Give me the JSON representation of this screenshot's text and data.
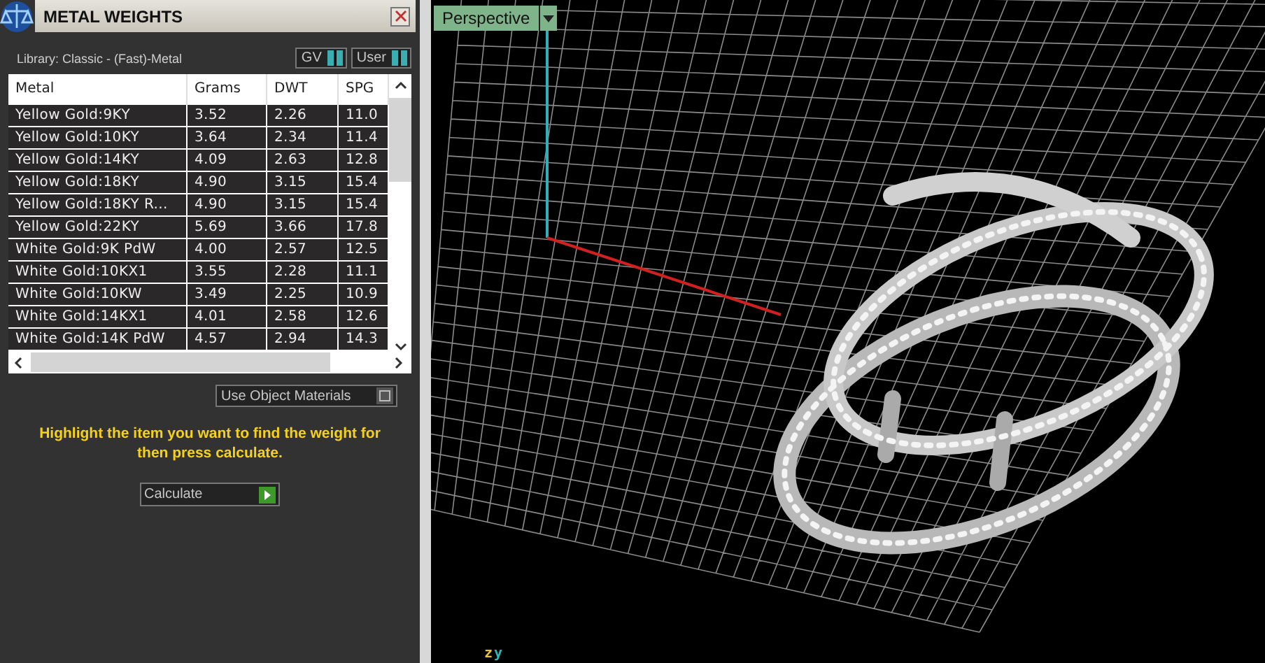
{
  "panel": {
    "title": "METAL WEIGHTS",
    "library": "Library: Classic - (Fast)-Metal",
    "toggles": [
      {
        "label": "GV",
        "on": true
      },
      {
        "label": "User",
        "on": true
      }
    ]
  },
  "table": {
    "columns": [
      "Metal",
      "Grams",
      "DWT",
      "SPG"
    ],
    "rows": [
      {
        "metal": "Yellow Gold:9KY",
        "grams": "3.52",
        "dwt": "2.26",
        "spg": "11.0"
      },
      {
        "metal": "Yellow Gold:10KY",
        "grams": "3.64",
        "dwt": "2.34",
        "spg": "11.4"
      },
      {
        "metal": "Yellow Gold:14KY",
        "grams": "4.09",
        "dwt": "2.63",
        "spg": "12.8"
      },
      {
        "metal": "Yellow Gold:18KY",
        "grams": "4.90",
        "dwt": "3.15",
        "spg": "15.4"
      },
      {
        "metal": "Yellow Gold:18KY R...",
        "grams": "4.90",
        "dwt": "3.15",
        "spg": "15.4"
      },
      {
        "metal": "Yellow Gold:22KY",
        "grams": "5.69",
        "dwt": "3.66",
        "spg": "17.8"
      },
      {
        "metal": "White Gold:9K PdW",
        "grams": "4.00",
        "dwt": "2.57",
        "spg": "12.5"
      },
      {
        "metal": "White Gold:10KX1",
        "grams": "3.55",
        "dwt": "2.28",
        "spg": "11.1"
      },
      {
        "metal": "White Gold:10KW",
        "grams": "3.49",
        "dwt": "2.25",
        "spg": "10.9"
      },
      {
        "metal": "White Gold:14KX1",
        "grams": "4.01",
        "dwt": "2.58",
        "spg": "12.6"
      },
      {
        "metal": "White Gold:14K PdW",
        "grams": "4.57",
        "dwt": "2.94",
        "spg": "14.3"
      }
    ]
  },
  "use_object_materials": {
    "label": "Use Object Materials",
    "on": false
  },
  "instruction": "Highlight the item you want to find the weight for then press calculate.",
  "calculate_button": "Calculate",
  "viewport": {
    "view": "Perspective",
    "axis_labels": [
      "z",
      "y"
    ]
  }
}
